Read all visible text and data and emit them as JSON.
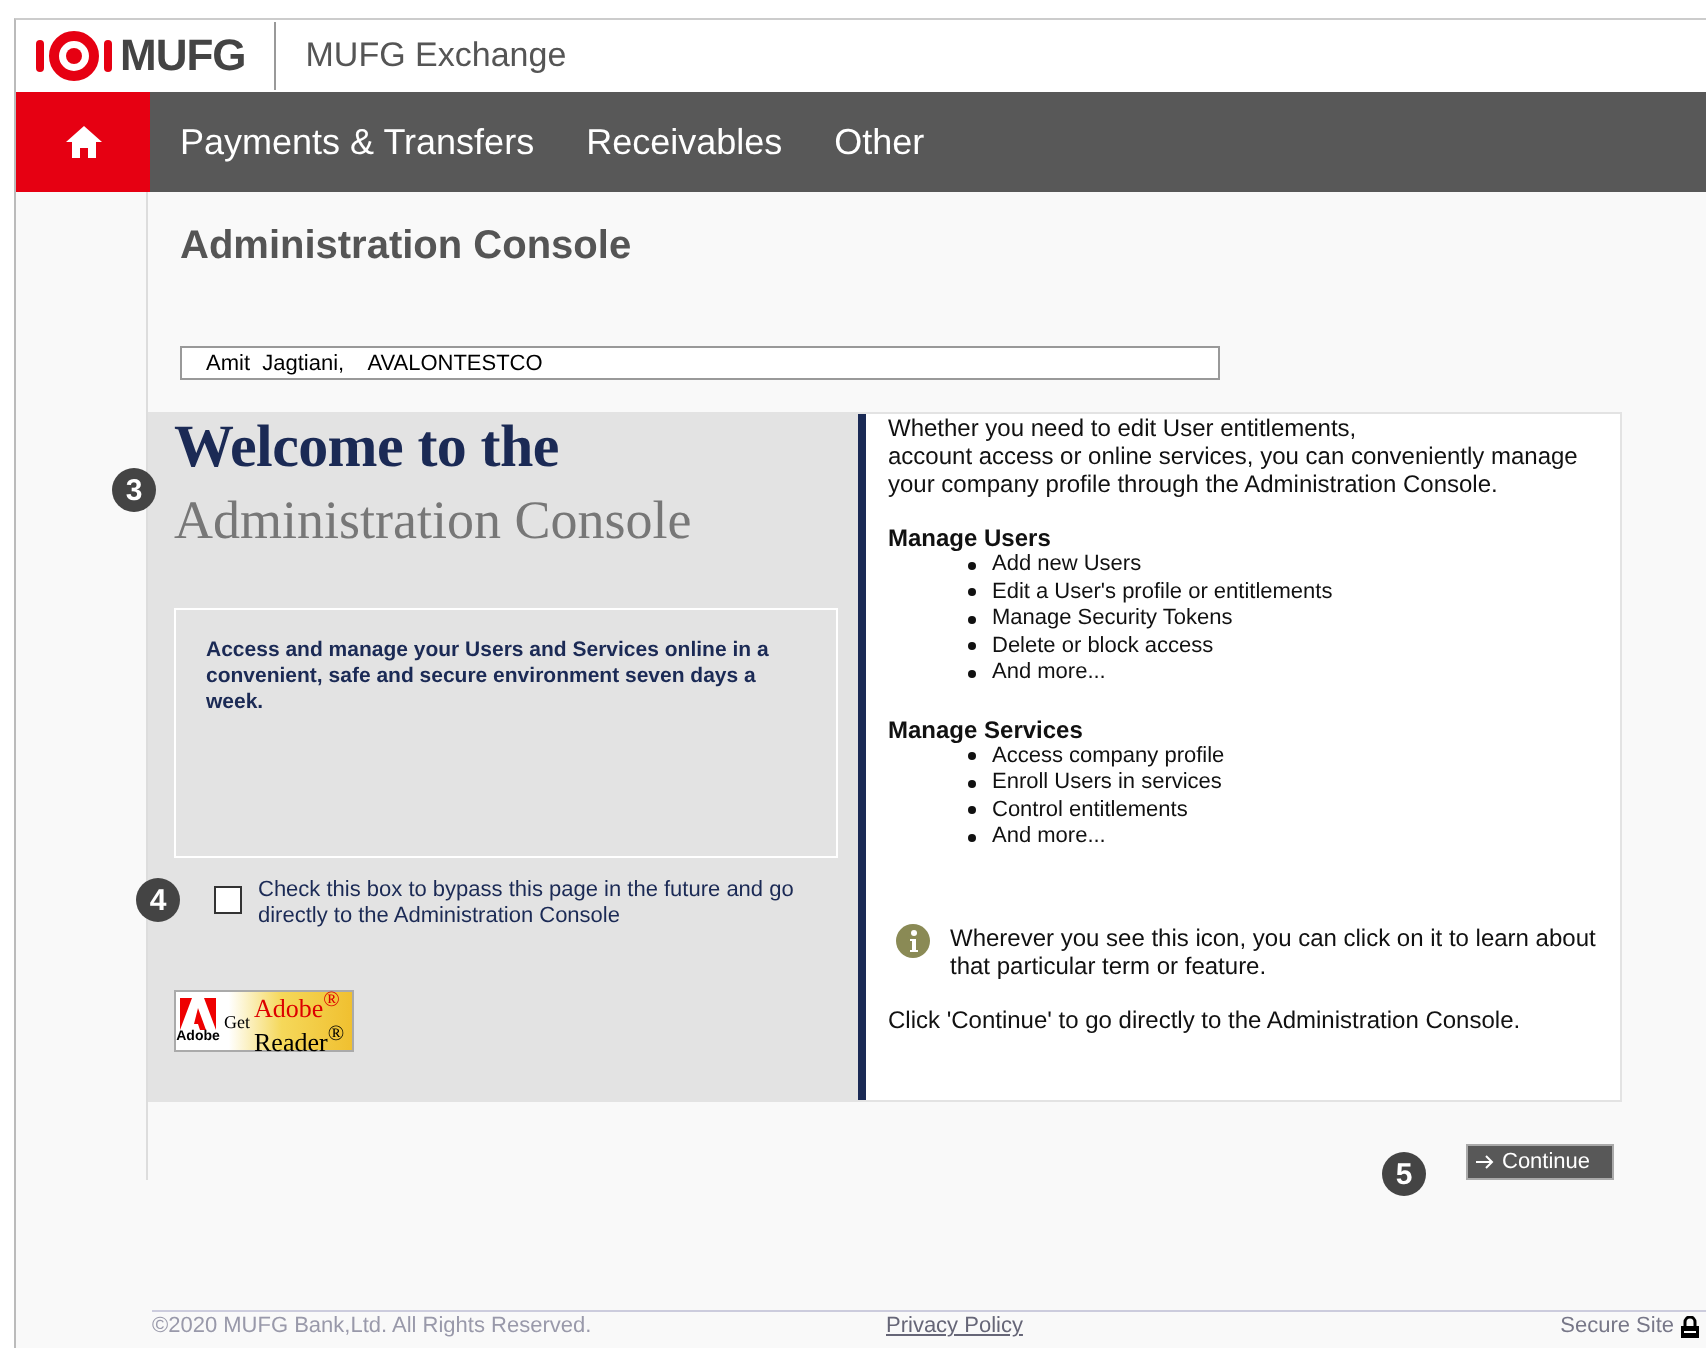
{
  "header": {
    "logo": "MUFG",
    "app_name": "MUFG Exchange"
  },
  "nav": {
    "items": [
      {
        "label": "Payments & Transfers"
      },
      {
        "label": "Receivables"
      },
      {
        "label": "Other"
      }
    ]
  },
  "page_title": "Administration Console",
  "user_field": {
    "value": "Amit  Jagtiani,    AVALONTESTCO"
  },
  "welcome": {
    "line1": "Welcome to the",
    "line2": "Administration Console",
    "intro": "Access and manage your Users and Services online in a convenient, safe and secure environment seven days a week."
  },
  "bypass": {
    "label": "Check this box to bypass this page in the future and go directly to the Administration Console",
    "checked": false
  },
  "adobe_badge": {
    "get": "Get",
    "brand": "Adobe$^{®}$",
    "product": "Reader$^{®}$",
    "maker": "Adobe"
  },
  "info": {
    "lead": "Whether you need to edit User entitlements,",
    "lead2": "account access or online services, you can conveniently manage your company profile through the Administration Console.",
    "sections": [
      {
        "title": "Manage Users",
        "items": [
          "Add new Users",
          "Edit a User's profile or entitlements",
          "Manage Security Tokens",
          "Delete or block access",
          "And more..."
        ]
      },
      {
        "title": "Manage Services",
        "items": [
          "Access company profile",
          "Enroll Users in services",
          "Control entitlements",
          "And more..."
        ]
      }
    ],
    "icon_note": "Wherever you see this icon, you can click on it to learn about that particular term or feature.",
    "continue_note": "Click 'Continue' to go directly to the Administration Console."
  },
  "continue_button": "Continue",
  "callouts": [
    "3",
    "4",
    "5"
  ],
  "footer": {
    "copyright": "©2020 MUFG Bank,Ltd. All Rights Reserved.",
    "privacy": "Privacy Policy",
    "secure": "Secure Site"
  }
}
